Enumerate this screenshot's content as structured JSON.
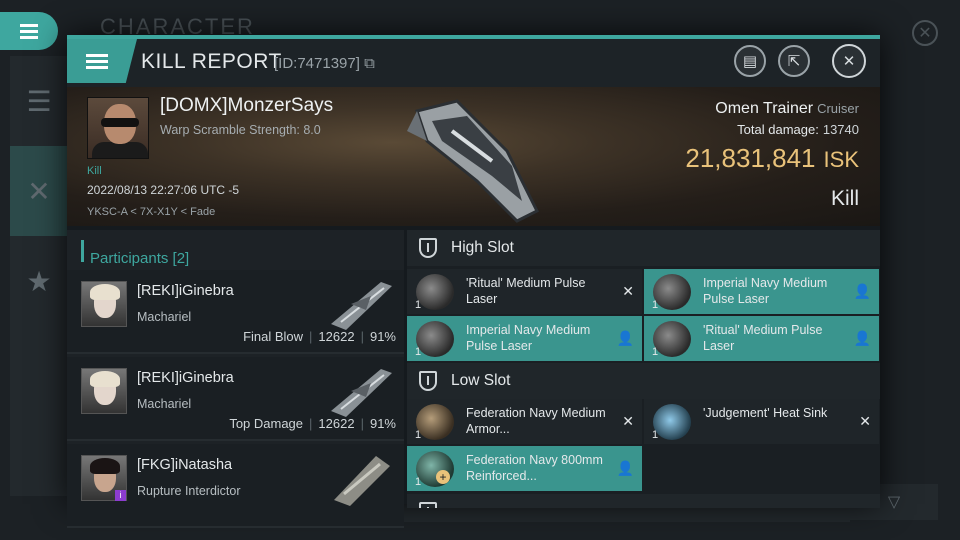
{
  "background": {
    "title": "CHARACTER"
  },
  "window": {
    "title": "KILL REPORT",
    "id_text": "[ID:7471397]"
  },
  "victim": {
    "name": "[DOMX]MonzerSays",
    "warp_scramble": "Warp Scramble Strength: 8.0",
    "tag": "Kill",
    "date": "2022/08/13 22:27:06 UTC -5",
    "location": "YKSC-A < 7X-X1Y < Fade",
    "ship_name": "Omen Trainer",
    "ship_class": "Cruiser",
    "total_damage_label": "Total damage:",
    "total_damage": "13740",
    "isk_value": "21,831,841",
    "isk_unit": "ISK",
    "result": "Kill"
  },
  "participants": {
    "header": "Participants",
    "count": "[2]",
    "items": [
      {
        "name": "[REKI]iGinebra",
        "ship": "Machariel",
        "role": "Final Blow",
        "damage": "12622",
        "percent": "91%"
      },
      {
        "name": "[REKI]iGinebra",
        "ship": "Machariel",
        "role": "Top Damage",
        "damage": "12622",
        "percent": "91%"
      },
      {
        "name": "[FKG]iNatasha",
        "ship": "Rupture Interdictor",
        "badge": "i"
      }
    ]
  },
  "slots": {
    "high": {
      "title": "High Slot",
      "modules": [
        {
          "name": "'Ritual' Medium Pulse Laser",
          "qty": "1",
          "action": "✕"
        },
        {
          "name": "Imperial Navy Medium Pulse Laser",
          "qty": "1",
          "action": "👤"
        },
        {
          "name": "Imperial Navy Medium Pulse Laser",
          "qty": "1",
          "action": "👤"
        },
        {
          "name": "'Ritual' Medium Pulse Laser",
          "qty": "1",
          "action": "👤"
        }
      ]
    },
    "low": {
      "title": "Low Slot",
      "modules": [
        {
          "name": "Federation Navy Medium Armor...",
          "qty": "1",
          "action": "✕"
        },
        {
          "name": "'Judgement' Heat Sink",
          "qty": "1",
          "action": "✕"
        },
        {
          "name": "Federation Navy 800mm Reinforced...",
          "qty": "1",
          "action": "👤"
        }
      ]
    }
  }
}
